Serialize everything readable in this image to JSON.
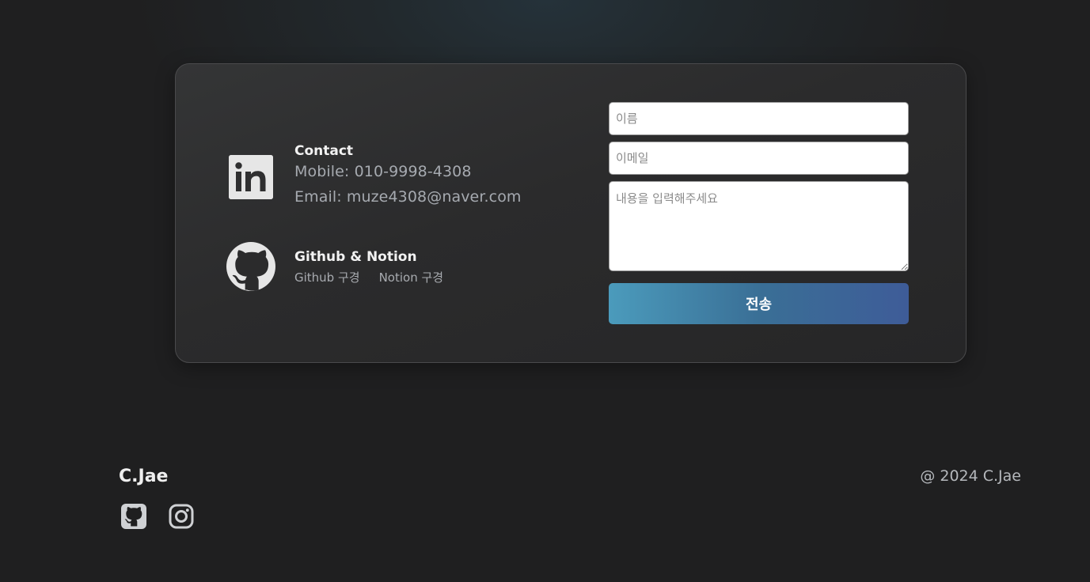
{
  "contact": {
    "title": "Contact",
    "mobile": "Mobile: 010-9998-4308",
    "email": "Email: muze4308@naver.com",
    "icon": "linkedin-icon"
  },
  "github_notion": {
    "title": "Github & Notion",
    "github_link": "Github 구경",
    "notion_link": "Notion 구경",
    "icon": "github-icon"
  },
  "form": {
    "name_placeholder": "이름",
    "email_placeholder": "이메일",
    "message_placeholder": "내용을 입력해주세요",
    "submit_label": "전송"
  },
  "footer": {
    "brand": "C.Jae",
    "copyright": "@ 2024 C.Jae",
    "icons": [
      "github-icon",
      "instagram-icon"
    ]
  },
  "colors": {
    "background": "#1f1f20",
    "card": "#2c2c2d",
    "button_start": "#4b9bbc",
    "button_end": "#3e5c98"
  }
}
